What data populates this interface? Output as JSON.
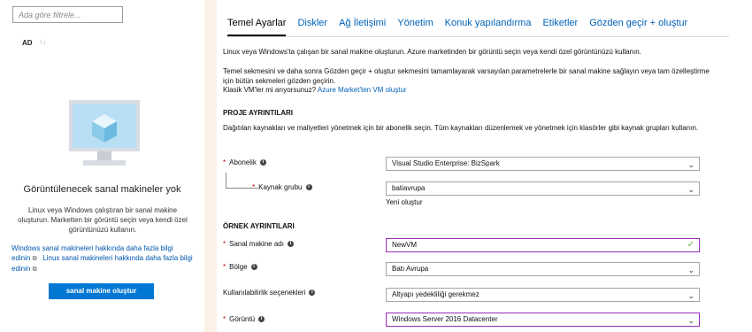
{
  "left": {
    "filter_placeholder": "Ada göre filtrele...",
    "column_header": "AD",
    "sort_arrow": "↑↓",
    "empty_title": "Görüntülenecek sanal makineler yok",
    "empty_description": "Linux veya Windows çalıştıran bir sanal makine oluşturun. Marketten bir görüntü seçin veya kendi özel görüntünüzü kullanın.",
    "link1": "Windows sanal makineleri hakkında daha fazla bilgi edinin",
    "link2": "Linux sanal makineleri hakkında daha fazla bilgi edinin",
    "create_button": "sanal makine oluştur"
  },
  "tabs": [
    {
      "label": "Temel Ayarlar",
      "active": true
    },
    {
      "label": "Diskler",
      "active": false
    },
    {
      "label": "Ağ İletişimi",
      "active": false
    },
    {
      "label": "Yönetim",
      "active": false
    },
    {
      "label": "Konuk yapılandırma",
      "active": false
    },
    {
      "label": "Etiketler",
      "active": false
    },
    {
      "label": "Gözden geçir + oluştur",
      "active": false
    }
  ],
  "intro": {
    "p1": "Linux veya Windows'ta çalışan bir sanal makine oluşturun. Azure marketinden bir görüntü seçin veya kendi özel görüntünüzü kullanın.",
    "p2": "Temel sekmesini ve daha sonra Gözden geçir + oluştur sekmesini tamamlayarak varsayılan parametrelerle bir sanal makine sağlayın veya tam özelleştirme için bütün sekmeleri gözden geçirin.",
    "p3_text": "Klasik VM'ler mi arıyorsunuz?",
    "p3_link": "Azure Market'ten VM oluştur"
  },
  "project": {
    "heading": "PROJE AYRINTILARI",
    "description": "Dağıtılan kaynakları ve maliyetleri yönetmek için bir abonelik seçin. Tüm kaynakları düzenlemek ve yönetmek için klasörler gibi kaynak grupları kullanın.",
    "subscription_label": "Abonelik",
    "subscription_value": "Visual Studio Enterprise: BizSpark",
    "resource_group_label": "Kaynak grubu",
    "resource_group_value": "batiavrupa",
    "create_new_link": "Yeni oluştur"
  },
  "instance": {
    "heading": "ÖRNEK AYRINTILARI",
    "vm_name_label": "Sanal makine adı",
    "vm_name_value": "NewVM",
    "region_label": "Bölge",
    "region_value": "Batı Avrupa",
    "availability_label": "Kullanılabilirlik seçenekleri",
    "availability_value": "Altyapı yedekliliği gerekmez",
    "image_label": "Görüntü",
    "image_value": "Windows Server 2016 Datacenter"
  },
  "icons": {
    "info": "i",
    "chevron": "⌄",
    "check": "✓",
    "required": "*",
    "external": "⧉"
  },
  "colors": {
    "accent": "#0078d4",
    "link": "#0062b8",
    "required": "#c00000",
    "highlight_border": "#9a2db7",
    "valid": "#6ab23e"
  }
}
